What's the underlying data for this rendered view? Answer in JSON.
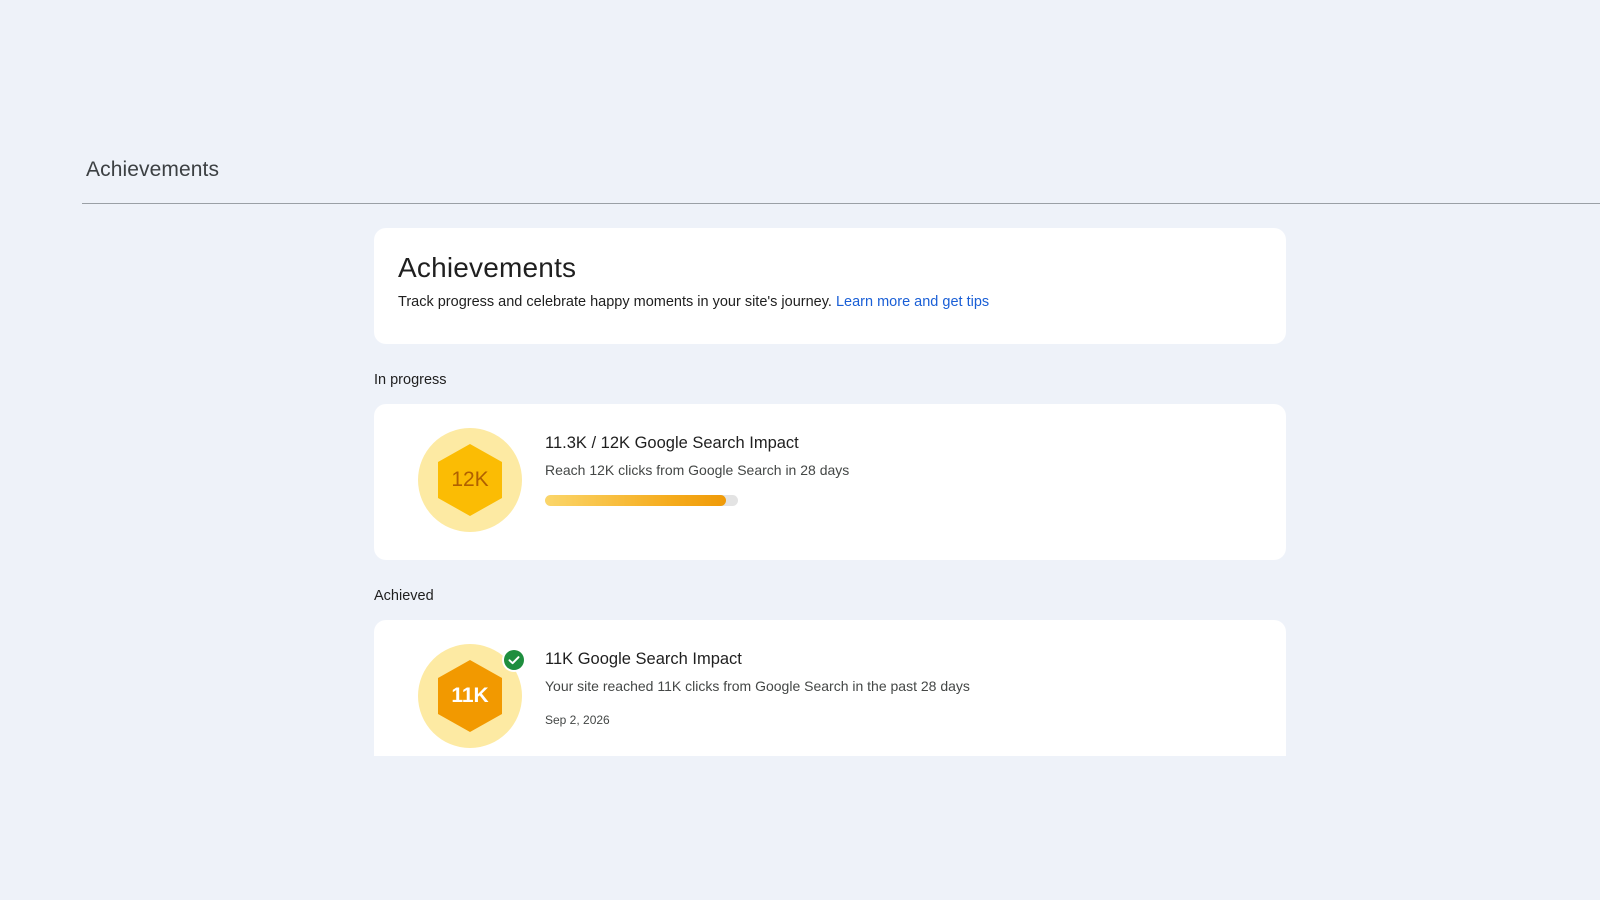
{
  "header": {
    "title": "Achievements"
  },
  "intro": {
    "title": "Achievements",
    "description": "Track progress and celebrate happy moments in your site's journey. ",
    "link_label": "Learn more and get tips"
  },
  "in_progress": {
    "section_label": "In progress",
    "items": [
      {
        "badge_label": "12K",
        "title": "11.3K / 12K Google Search Impact",
        "description": "Reach 12K clicks from Google Search in 28 days",
        "progress_fraction": 0.94
      }
    ]
  },
  "achieved": {
    "section_label": "Achieved",
    "items": [
      {
        "badge_label": "11K",
        "title": "11K Google Search Impact",
        "description": "Your site reached 11K clicks from Google Search in the past 28 days",
        "date": "Sep 2, 2026",
        "status_icon": "check-circle-icon"
      }
    ]
  },
  "colors": {
    "background": "#eef2f9",
    "card": "#ffffff",
    "link": "#1a5fd6",
    "badge_ring": "#fdeaa3",
    "badge_in_progress": "#fbbc04",
    "badge_achieved": "#f29900",
    "check": "#1e8e3e"
  }
}
